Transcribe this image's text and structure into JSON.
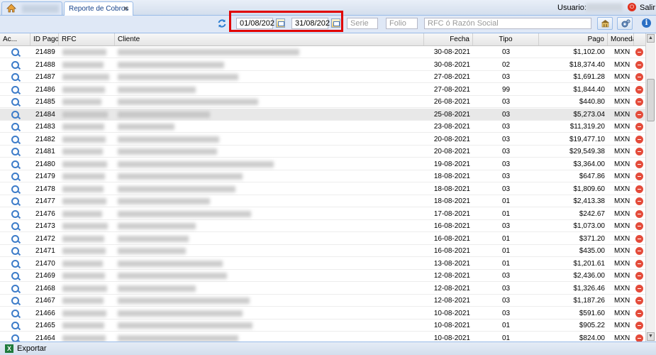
{
  "topbar": {
    "tab_report": "Reporte de Cobros",
    "tab_close": "×",
    "user_label": "Usuario:",
    "exit_label": "Salir"
  },
  "toolbar": {
    "date_from": "01/08/202",
    "date_to": "31/08/202",
    "serie_placeholder": "Serie",
    "folio_placeholder": "Folio",
    "rfc_placeholder": "RFC ó Razón Social",
    "highlight_color": "#e00000"
  },
  "columns": {
    "actions": "Ac...",
    "id_pago": "ID Pago",
    "rfc": "RFC",
    "cliente": "Cliente",
    "fecha": "Fecha",
    "tipo": "Tipo",
    "pago": "Pago",
    "moneda": "Moneda"
  },
  "rows": [
    {
      "id": "21489",
      "fecha": "30-08-2021",
      "tipo": "03",
      "pago": "$1,102.00",
      "moneda": "MXN"
    },
    {
      "id": "21488",
      "fecha": "30-08-2021",
      "tipo": "02",
      "pago": "$18,374.40",
      "moneda": "MXN"
    },
    {
      "id": "21487",
      "fecha": "27-08-2021",
      "tipo": "03",
      "pago": "$1,691.28",
      "moneda": "MXN"
    },
    {
      "id": "21486",
      "fecha": "27-08-2021",
      "tipo": "99",
      "pago": "$1,844.40",
      "moneda": "MXN"
    },
    {
      "id": "21485",
      "fecha": "26-08-2021",
      "tipo": "03",
      "pago": "$440.80",
      "moneda": "MXN"
    },
    {
      "id": "21484",
      "fecha": "25-08-2021",
      "tipo": "03",
      "pago": "$5,273.04",
      "moneda": "MXN"
    },
    {
      "id": "21483",
      "fecha": "23-08-2021",
      "tipo": "03",
      "pago": "$11,319.20",
      "moneda": "MXN"
    },
    {
      "id": "21482",
      "fecha": "20-08-2021",
      "tipo": "03",
      "pago": "$19,477.10",
      "moneda": "MXN"
    },
    {
      "id": "21481",
      "fecha": "20-08-2021",
      "tipo": "03",
      "pago": "$29,549.38",
      "moneda": "MXN"
    },
    {
      "id": "21480",
      "fecha": "19-08-2021",
      "tipo": "03",
      "pago": "$3,364.00",
      "moneda": "MXN"
    },
    {
      "id": "21479",
      "fecha": "18-08-2021",
      "tipo": "03",
      "pago": "$647.86",
      "moneda": "MXN"
    },
    {
      "id": "21478",
      "fecha": "18-08-2021",
      "tipo": "03",
      "pago": "$1,809.60",
      "moneda": "MXN"
    },
    {
      "id": "21477",
      "fecha": "18-08-2021",
      "tipo": "01",
      "pago": "$2,413.38",
      "moneda": "MXN"
    },
    {
      "id": "21476",
      "fecha": "17-08-2021",
      "tipo": "01",
      "pago": "$242.67",
      "moneda": "MXN"
    },
    {
      "id": "21473",
      "fecha": "16-08-2021",
      "tipo": "03",
      "pago": "$1,073.00",
      "moneda": "MXN"
    },
    {
      "id": "21472",
      "fecha": "16-08-2021",
      "tipo": "01",
      "pago": "$371.20",
      "moneda": "MXN"
    },
    {
      "id": "21471",
      "fecha": "16-08-2021",
      "tipo": "01",
      "pago": "$435.00",
      "moneda": "MXN"
    },
    {
      "id": "21470",
      "fecha": "13-08-2021",
      "tipo": "01",
      "pago": "$1,201.61",
      "moneda": "MXN"
    },
    {
      "id": "21469",
      "fecha": "12-08-2021",
      "tipo": "03",
      "pago": "$2,436.00",
      "moneda": "MXN"
    },
    {
      "id": "21468",
      "fecha": "12-08-2021",
      "tipo": "03",
      "pago": "$1,326.46",
      "moneda": "MXN"
    },
    {
      "id": "21467",
      "fecha": "12-08-2021",
      "tipo": "03",
      "pago": "$1,187.26",
      "moneda": "MXN"
    },
    {
      "id": "21466",
      "fecha": "10-08-2021",
      "tipo": "03",
      "pago": "$591.60",
      "moneda": "MXN"
    },
    {
      "id": "21465",
      "fecha": "10-08-2021",
      "tipo": "01",
      "pago": "$905.22",
      "moneda": "MXN"
    },
    {
      "id": "21464",
      "fecha": "10-08-2021",
      "tipo": "01",
      "pago": "$824.00",
      "moneda": "MXN"
    }
  ],
  "footer": {
    "export_label": "Exportar"
  }
}
